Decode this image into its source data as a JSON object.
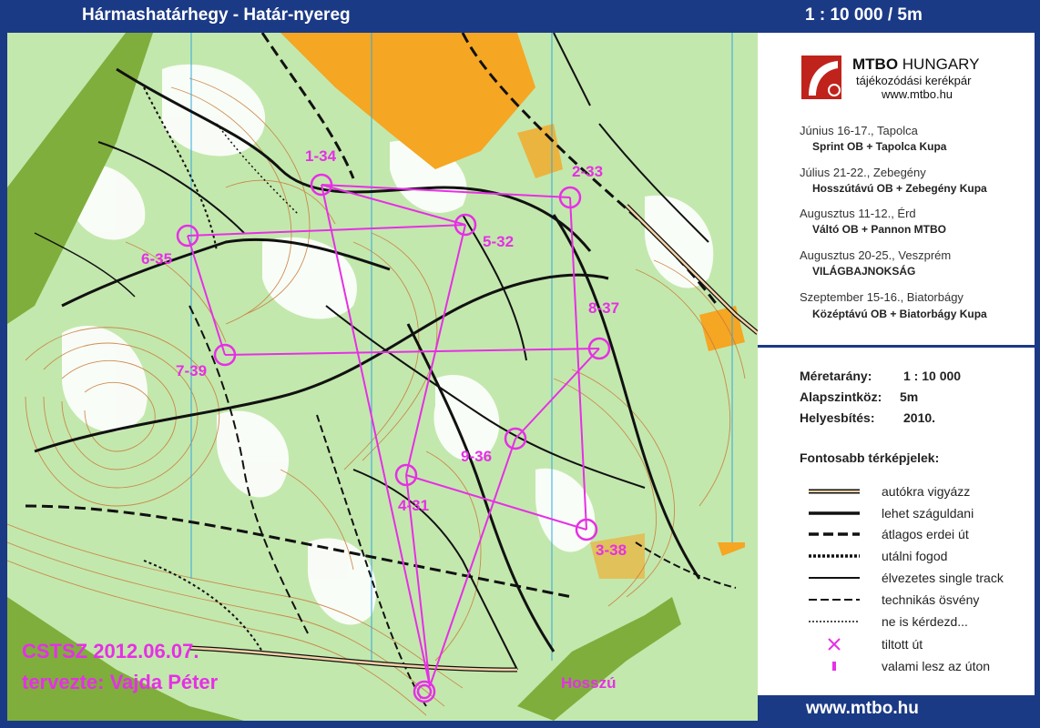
{
  "header": {
    "title": "Hármashatárhegy - Határ-nyereg",
    "scale": "1 : 10 000 / 5m"
  },
  "footer": {
    "url": "www.mtbo.hu"
  },
  "logo": {
    "brand_bold": "MTBO",
    "brand_rest": " HUNGARY",
    "subtitle": "tájékozódási kerékpár",
    "url": "www.mtbo.hu"
  },
  "events": [
    {
      "place": "Június 16-17., Tapolca",
      "title": "Sprint OB + Tapolca Kupa"
    },
    {
      "place": "Július 21-22., Zebegény",
      "title": "Hosszútávú OB + Zebegény Kupa"
    },
    {
      "place": "Augusztus 11-12., Érd",
      "title": "Váltó OB + Pannon MTBO"
    },
    {
      "place": "Augusztus 20-25., Veszprém",
      "title": "VILÁGBAJNOKSÁG"
    },
    {
      "place": "Szeptember 15-16., Biatorbágy",
      "title": "Középtávú OB + Biatorbágy Kupa"
    }
  ],
  "map_info": {
    "scale_label": "Méretarány:",
    "scale_value": "1 : 10 000",
    "contour_label": "Alapszintköz:",
    "contour_value": "5m",
    "revision_label": "Helyesbítés:",
    "revision_value": "2010."
  },
  "legend": {
    "title": "Fontosabb térképjelek:",
    "items": [
      {
        "label": "autókra vigyázz",
        "symbol": "road"
      },
      {
        "label": "lehet száguldani",
        "symbol": "thick-solid"
      },
      {
        "label": "átlagos erdei út",
        "symbol": "thick-dashed"
      },
      {
        "label": "utálni fogod",
        "symbol": "thick-dotted"
      },
      {
        "label": "élvezetes single track",
        "symbol": "thin-solid"
      },
      {
        "label": "technikás ösvény",
        "symbol": "thin-dashed"
      },
      {
        "label": "ne is kérdezd...",
        "symbol": "thin-dotted"
      },
      {
        "label": "tiltott út",
        "symbol": "cross"
      },
      {
        "label": "valami lesz az úton",
        "symbol": "bar"
      }
    ]
  },
  "course": {
    "name": "Hosszú",
    "credit_line1": "CSTSZ 2012.06.07.",
    "credit_line2": "tervezte: Vajda Péter",
    "controls": [
      "1-34",
      "2-33",
      "5-32",
      "6-35",
      "8-37",
      "7-39",
      "9-36",
      "4-31",
      "3-38"
    ]
  },
  "colors": {
    "course": "#e62fe6",
    "frame": "#1b3a86",
    "forest": "#c3e8ad",
    "open": "#f5a623",
    "white_forest": "#ffffff"
  }
}
